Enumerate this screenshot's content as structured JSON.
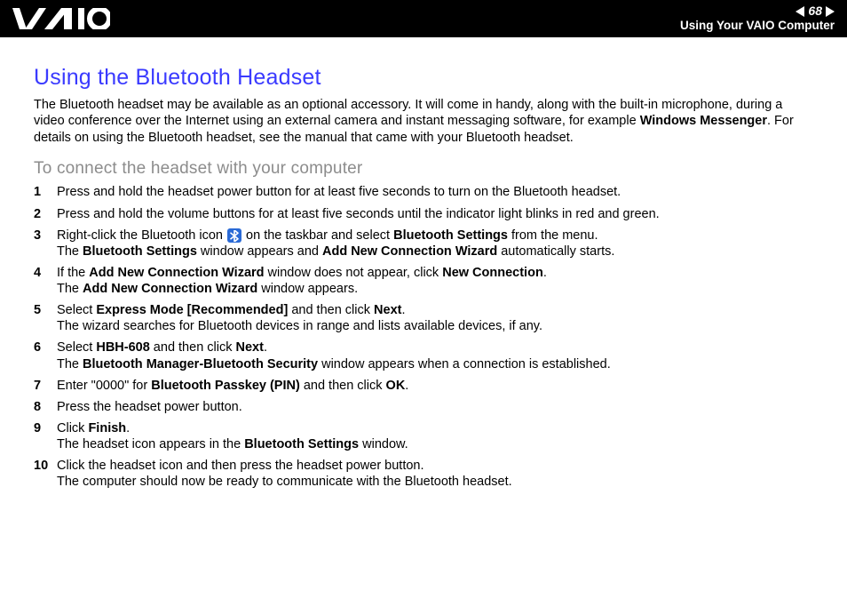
{
  "header": {
    "page_number": "68",
    "section": "Using Your VAIO Computer"
  },
  "title": "Using the Bluetooth Headset",
  "intro": {
    "pre": "The Bluetooth headset may be available as an optional accessory. It will come in handy, along with the built-in microphone, during a video conference over the Internet using an external camera and instant messaging software, for example ",
    "bold1": "Windows Messenger",
    "post": ". For details on using the Bluetooth headset, see the manual that came with your Bluetooth headset."
  },
  "subtitle": "To connect the headset with your computer",
  "steps": {
    "s1": {
      "num": "1",
      "text": "Press and hold the headset power button for at least five seconds to turn on the Bluetooth headset."
    },
    "s2": {
      "num": "2",
      "text": "Press and hold the volume buttons for at least five seconds until the indicator light blinks in red and green."
    },
    "s3": {
      "num": "3",
      "pre": "Right-click the Bluetooth icon ",
      "mid": " on the taskbar and select ",
      "b1": "Bluetooth Settings",
      "post1": " from the menu.",
      "line2a": "The ",
      "b2": "Bluetooth Settings",
      "line2b": " window appears and ",
      "b3": "Add New Connection Wizard",
      "line2c": " automatically starts."
    },
    "s4": {
      "num": "4",
      "l1a": "If the ",
      "b1": "Add New Connection Wizard",
      "l1b": " window does not appear, click ",
      "b2": "New Connection",
      "l1c": ".",
      "l2a": "The ",
      "b3": "Add New Connection Wizard",
      "l2b": " window appears."
    },
    "s5": {
      "num": "5",
      "l1a": "Select ",
      "b1": "Express Mode [Recommended]",
      "l1b": " and then click ",
      "b2": "Next",
      "l1c": ".",
      "l2": "The wizard searches for Bluetooth devices in range and lists available devices, if any."
    },
    "s6": {
      "num": "6",
      "l1a": "Select ",
      "b1": "HBH-608",
      "l1b": " and then click ",
      "b2": "Next",
      "l1c": ".",
      "l2a": "The ",
      "b3": "Bluetooth Manager-Bluetooth Security",
      "l2b": " window appears when a connection is established."
    },
    "s7": {
      "num": "7",
      "l1a": "Enter \"0000\" for ",
      "b1": "Bluetooth Passkey (PIN)",
      "l1b": " and then click ",
      "b2": "OK",
      "l1c": "."
    },
    "s8": {
      "num": "8",
      "text": "Press the headset power button."
    },
    "s9": {
      "num": "9",
      "l1a": "Click ",
      "b1": "Finish",
      "l1b": ".",
      "l2a": "The headset icon appears in the ",
      "b2": "Bluetooth Settings",
      "l2b": " window."
    },
    "s10": {
      "num": "10",
      "l1": "Click the headset icon and then press the headset power button.",
      "l2": "The computer should now be ready to communicate with the Bluetooth headset."
    }
  }
}
